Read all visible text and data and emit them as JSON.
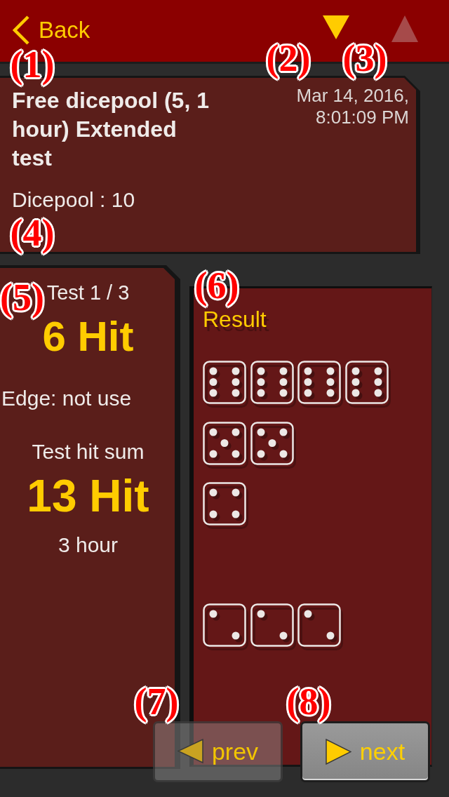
{
  "top_bar": {
    "back": {
      "label": "Back"
    },
    "nav_arrows": [
      {
        "kind": "down",
        "disabled": false
      },
      {
        "kind": "up",
        "disabled": true
      }
    ]
  },
  "header": {
    "title": "Free dicepool (5, 1 hour) Extended test",
    "timestamp": "Mar 14, 2016, 8:01:09 PM",
    "dicepool": "Dicepool : 10"
  },
  "test_panel": {
    "test_label": "Test 1 / 3",
    "hits": "6 Hit",
    "edge": "Edge: not use",
    "sum_label": "Test hit sum",
    "sum_hits": "13 Hit",
    "duration": "3 hour"
  },
  "result_panel": {
    "title": "Result",
    "dice": [
      {
        "kind": "six"
      },
      {
        "kind": "six"
      },
      {
        "kind": "six"
      },
      {
        "kind": "six"
      },
      {
        "kind": "five"
      },
      {
        "kind": "five"
      },
      {
        "kind": "four"
      },
      {
        "kind": "two"
      },
      {
        "kind": "two"
      },
      {
        "kind": "two"
      }
    ]
  },
  "buttons": [
    {
      "kind": "prev",
      "label": "prev",
      "disabled": true
    },
    {
      "kind": "next",
      "label": "next",
      "disabled": false
    }
  ],
  "callouts": [
    "(1)",
    "(2)",
    "(3)",
    "(4)",
    "(5)",
    "(6)",
    "(7)",
    "(8)"
  ]
}
